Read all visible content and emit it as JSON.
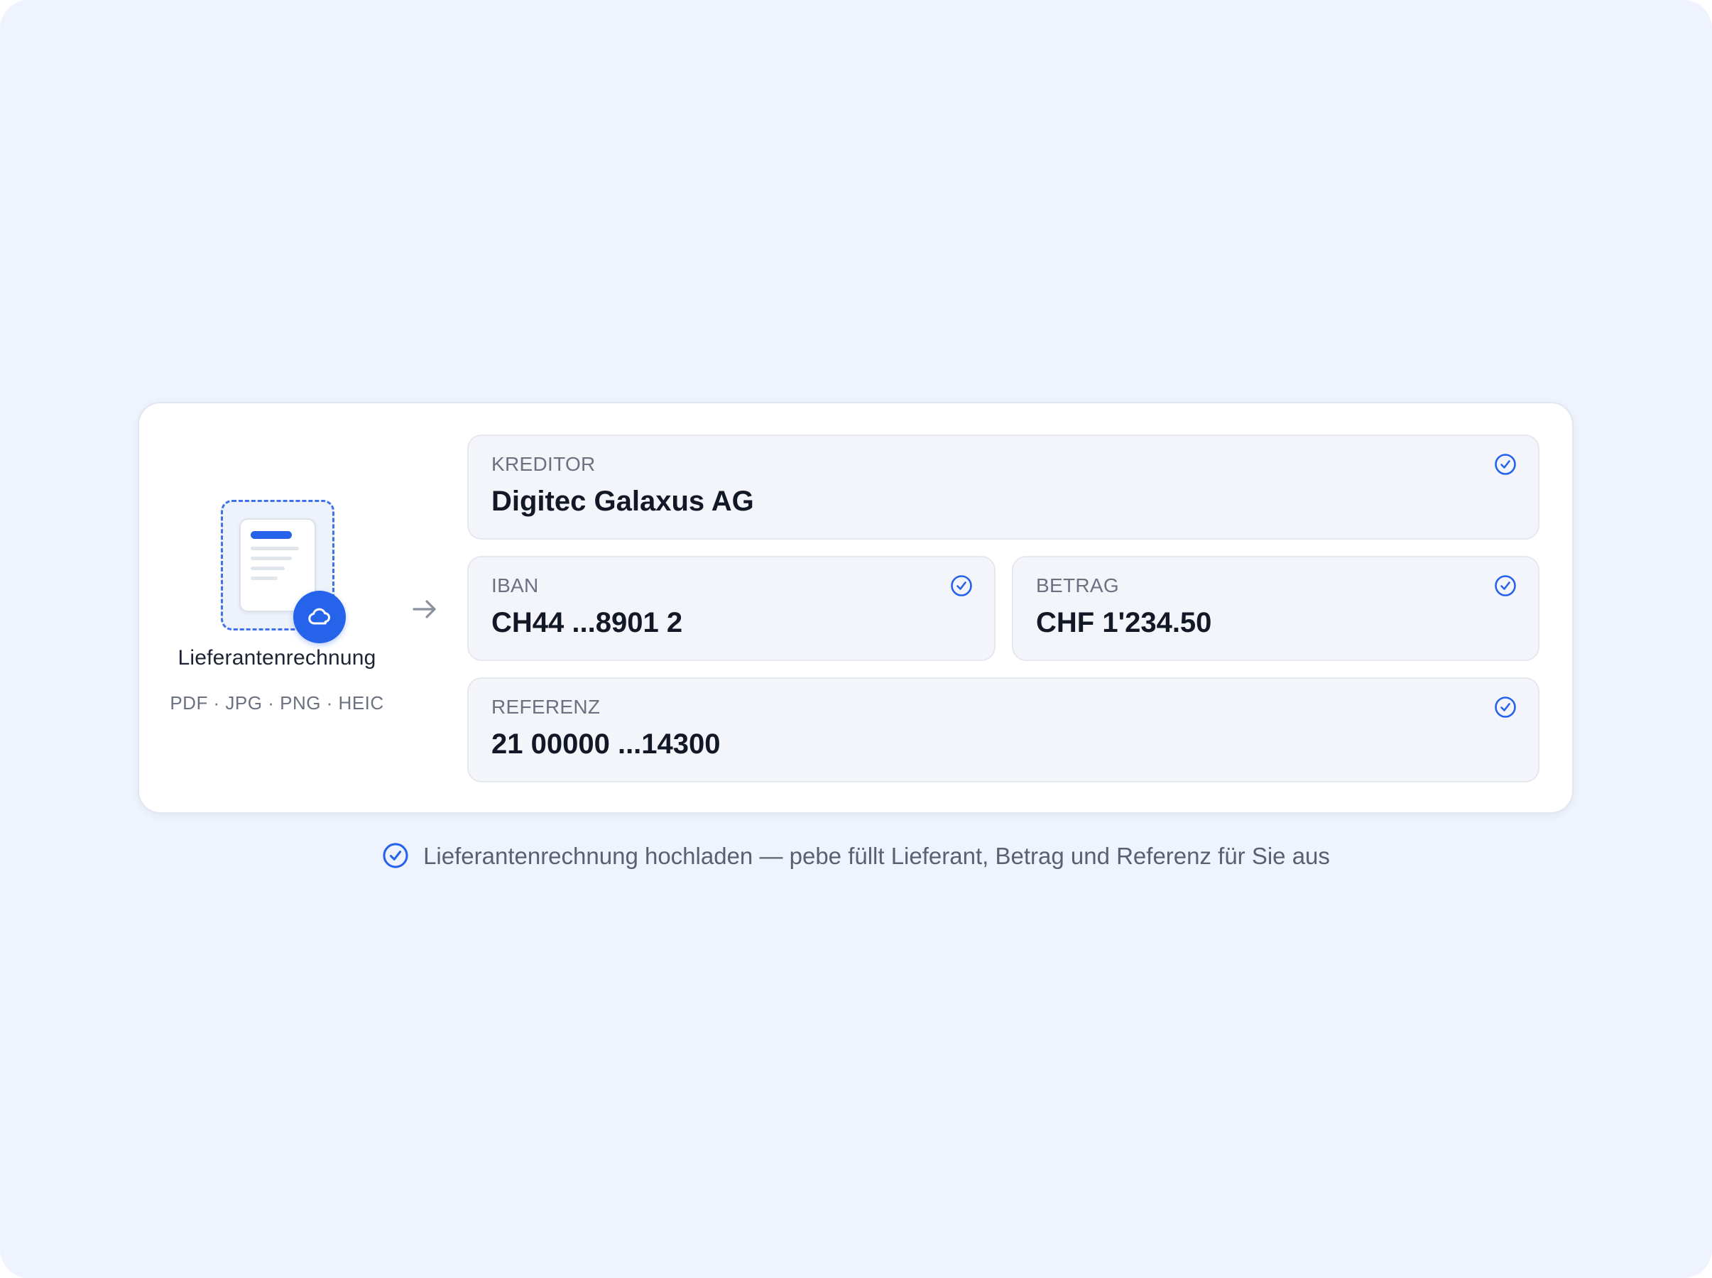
{
  "upload": {
    "title": "Lieferantenrechnung",
    "formats": "PDF · JPG · PNG · HEIC",
    "document_icon": "document-icon",
    "badge_icon": "cloud-upload-icon",
    "arrow_icon": "arrow-right-icon"
  },
  "fields": {
    "kreditor": {
      "label": "KREDITOR",
      "value": "Digitec Galaxus AG",
      "status_icon": "check-circle-icon"
    },
    "iban": {
      "label": "IBAN",
      "value": "CH44 ...8901 2",
      "status_icon": "check-circle-icon"
    },
    "betrag": {
      "label": "BETRAG",
      "value": "CHF 1'234.50",
      "status_icon": "check-circle-icon"
    },
    "referenz": {
      "label": "REFERENZ",
      "value": "21 00000 ...14300",
      "status_icon": "check-circle-icon"
    }
  },
  "caption": {
    "text": "Lieferantenrechnung hochladen — pebe füllt Lieferant, Betrag und Referenz für Sie aus",
    "icon": "check-circle-icon"
  },
  "colors": {
    "background": "#eff3fd",
    "accent": "#2563eb",
    "field_background": "#f4f5fa",
    "text_primary": "#131826",
    "text_muted": "#6b7180"
  }
}
